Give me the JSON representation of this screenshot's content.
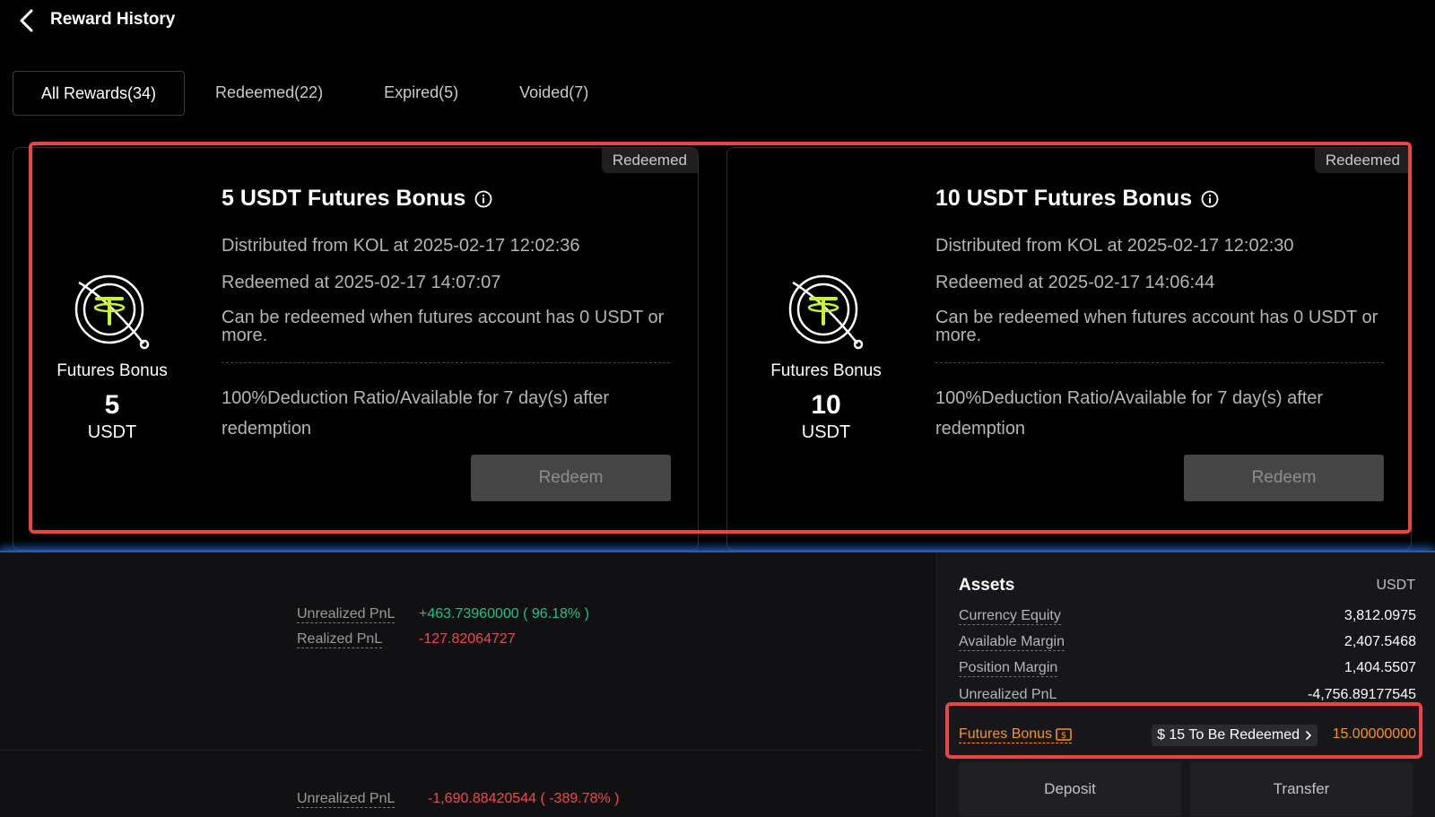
{
  "header": {
    "title": "Reward History"
  },
  "tabs": [
    {
      "label": "All Rewards(34)",
      "active": true
    },
    {
      "label": "Redeemed(22)"
    },
    {
      "label": "Expired(5)"
    },
    {
      "label": "Voided(7)"
    }
  ],
  "cards": [
    {
      "badge": "Redeemed",
      "type": "Futures Bonus",
      "amount": "5",
      "unit": "USDT",
      "title": "5 USDT Futures Bonus",
      "distributed": "Distributed from KOL at 2025-02-17 12:02:36",
      "redeemed": "Redeemed at 2025-02-17 14:07:07",
      "condition": "Can be redeemed when futures account has 0 USDT or more.",
      "deduction": "100%Deduction Ratio/Available for 7 day(s) after redemption",
      "button": "Redeem"
    },
    {
      "badge": "Redeemed",
      "type": "Futures Bonus",
      "amount": "10",
      "unit": "USDT",
      "title": "10 USDT Futures Bonus",
      "distributed": "Distributed from KOL at 2025-02-17 12:02:30",
      "redeemed": "Redeemed at 2025-02-17 14:06:44",
      "condition": "Can be redeemed when futures account has 0 USDT or more.",
      "deduction": "100%Deduction Ratio/Available for 7 day(s) after redemption",
      "button": "Redeem"
    }
  ],
  "positions": {
    "unrealized_label": "Unrealized PnL",
    "unrealized_value": "+463.73960000 ( 96.18% )",
    "realized_label": "Realized PnL",
    "realized_value": "-127.82064727",
    "unrealized2_label": "Unrealized PnL",
    "unrealized2_value": "-1,690.88420544 ( -389.78% )"
  },
  "assets": {
    "title": "Assets",
    "unit": "USDT",
    "rows": [
      {
        "label": "Currency Equity",
        "value": "3,812.0975"
      },
      {
        "label": "Available Margin",
        "value": "2,407.5468"
      },
      {
        "label": "Position Margin",
        "value": "1,404.5507"
      },
      {
        "label": "Unrealized PnL",
        "value": "-4,756.89177545"
      }
    ],
    "bonus_label": "Futures Bonus",
    "pending": "$ 15 To Be Redeemed",
    "bonus_value": "15.00000000",
    "deposit": "Deposit",
    "transfer": "Transfer"
  },
  "colors": {
    "accent_orange": "#f7931a",
    "profit_green": "#20c087",
    "loss_red": "#ee4b47",
    "highlight_red": "#e94545",
    "coin_green": "#c8f531"
  },
  "icons": [
    "back-arrow-icon",
    "info-icon",
    "usdt-coin-icon",
    "dollar-square-icon",
    "chevron-right-icon"
  ]
}
